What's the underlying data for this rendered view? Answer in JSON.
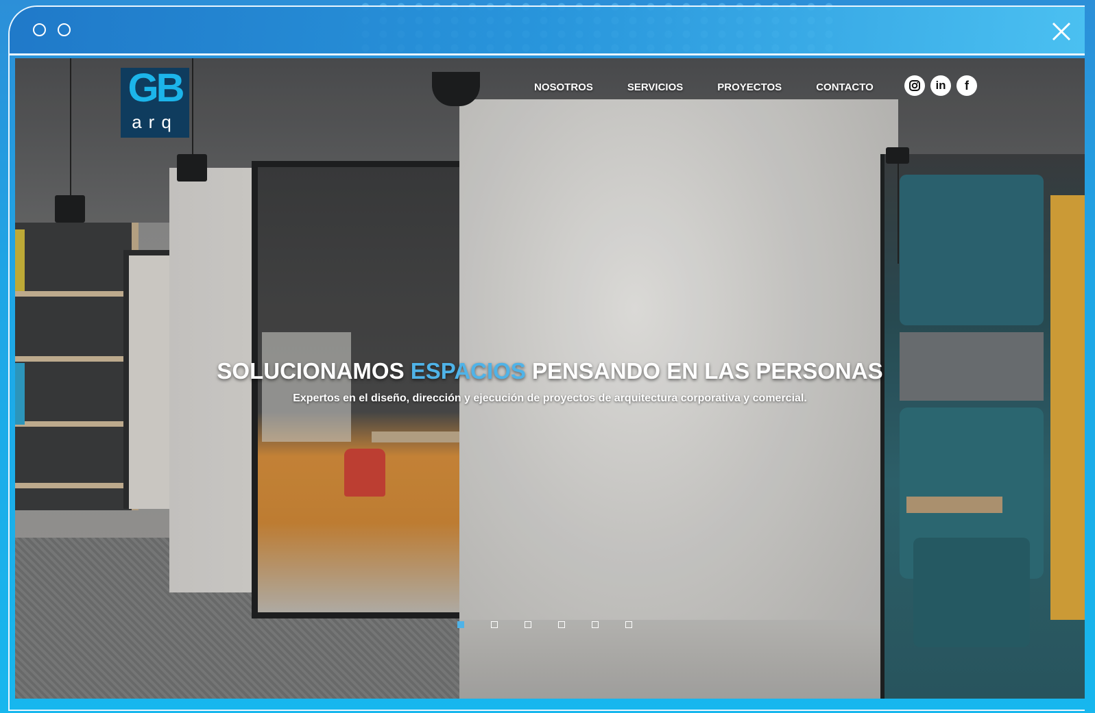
{
  "window": {
    "close_icon": "close-icon"
  },
  "logo": {
    "top": "GB",
    "bottom": "arq"
  },
  "nav": {
    "items": [
      {
        "label": "NOSOTROS"
      },
      {
        "label": "SERVICIOS"
      },
      {
        "label": "PROYECTOS"
      },
      {
        "label": "CONTACTO"
      }
    ]
  },
  "social": [
    {
      "name": "instagram-icon"
    },
    {
      "name": "linkedin-icon",
      "label": "in"
    },
    {
      "name": "facebook-icon",
      "label": "f"
    }
  ],
  "hero": {
    "title_before": "SOLUCIONAMOS ",
    "title_accent": "ESPACIOS",
    "title_after": " PENSANDO EN LAS PERSONAS",
    "subtitle": "Expertos en el diseño, dirección y ejecución de proyectos de arquitectura corporativa y comercial."
  },
  "slider": {
    "total": 6,
    "active_index": 0
  },
  "colors": {
    "accent": "#4fb3e8",
    "logo_bg": "#0f3c5e",
    "logo_text": "#1cb5ea",
    "frame": "#2a8fd6"
  }
}
